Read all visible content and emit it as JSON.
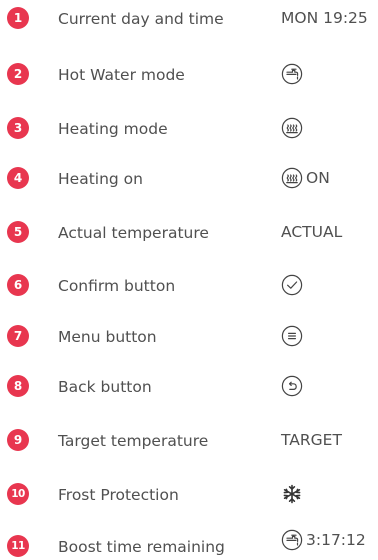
{
  "colors": {
    "badge": "#e8364f",
    "text": "#505050",
    "icon_stroke": "#444444"
  },
  "items": [
    {
      "number": "1",
      "label": "Current day and time",
      "value_text": "MON 19:25",
      "icon": null
    },
    {
      "number": "2",
      "label": "Hot Water mode",
      "value_text": "",
      "icon": "hot-water-tap-icon"
    },
    {
      "number": "3",
      "label": "Heating mode",
      "value_text": "",
      "icon": "radiator-icon"
    },
    {
      "number": "4",
      "label": "Heating on",
      "value_text": "ON",
      "icon": "radiator-icon"
    },
    {
      "number": "5",
      "label": "Actual temperature",
      "value_text": "ACTUAL",
      "icon": null
    },
    {
      "number": "6",
      "label": "Confirm button",
      "value_text": "",
      "icon": "check-circle-icon"
    },
    {
      "number": "7",
      "label": "Menu button",
      "value_text": "",
      "icon": "menu-circle-icon"
    },
    {
      "number": "8",
      "label": "Back button",
      "value_text": "",
      "icon": "back-arrow-circle-icon"
    },
    {
      "number": "9",
      "label": "Target temperature",
      "value_text": "TARGET",
      "icon": null
    },
    {
      "number": "10",
      "label": "Frost Protection",
      "value_text": "",
      "icon": "snowflake-icon"
    },
    {
      "number": "11",
      "label": "Boost time remaining",
      "value_text": "3:17:12",
      "icon": "hot-water-tap-icon"
    }
  ]
}
